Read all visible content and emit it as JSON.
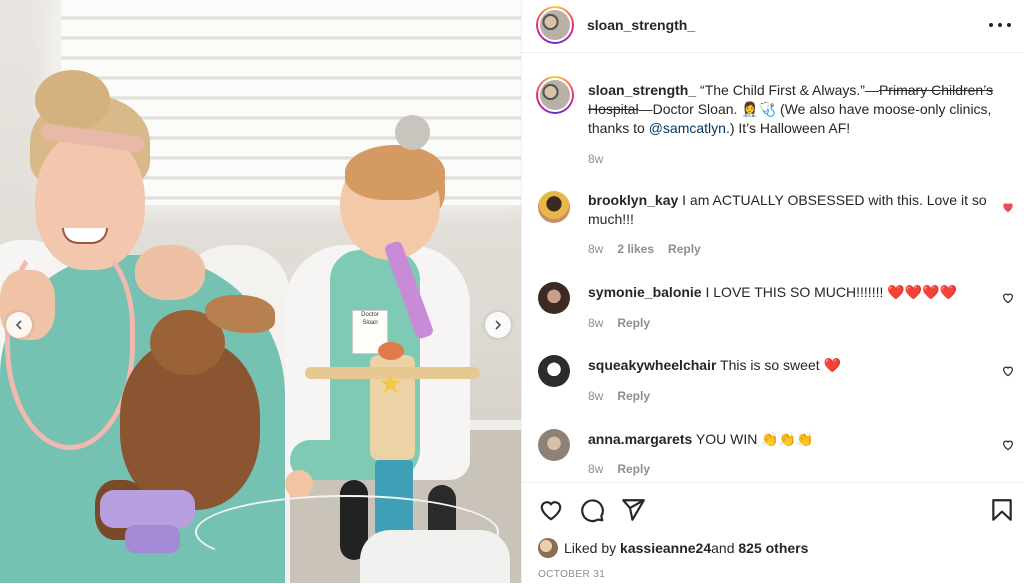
{
  "post": {
    "username": "sloan_strength_",
    "caption": {
      "username": "sloan_strength_",
      "quote": "“The Child First & Always.”—",
      "struck": "Primary Children’s Hospital",
      "after_strike": "—Doctor Sloan. 👩‍⚕️🩺 (We also have moose-only clinics, thanks to ",
      "mention": "@samcatlyn",
      "end": ".) It’s Halloween AF!",
      "time": "8w"
    },
    "photo": {
      "badge_text": "Doctor Sloan"
    },
    "comments": [
      {
        "username": "brooklyn_kay",
        "text": "I am ACTUALLY OBSESSED with this. Love it so much!!!",
        "time": "8w",
        "likes": "2 likes",
        "reply": "Reply",
        "liked": true,
        "avatar_color": "#c98b6b"
      },
      {
        "username": "symonie_balonie",
        "text": "I LOVE THIS SO MUCH!!!!!!! ❤️❤️❤️❤️",
        "time": "8w",
        "likes": "",
        "reply": "Reply",
        "liked": false,
        "avatar_color": "#6b4a3e"
      },
      {
        "username": "squeakywheelchair",
        "text": "This is so sweet ❤️",
        "time": "8w",
        "likes": "",
        "reply": "Reply",
        "liked": false,
        "avatar_color": "#3a3a3a"
      },
      {
        "username": "anna.margarets",
        "text": "YOU WIN 👏👏👏",
        "time": "8w",
        "likes": "",
        "reply": "Reply",
        "liked": false,
        "avatar_color": "#9a8f86"
      }
    ],
    "likes": {
      "prefix": "Liked by ",
      "user": "kassieanne24",
      "mid": " and ",
      "others": "825 others"
    },
    "date": "OCTOBER 31",
    "colors": {
      "heart_liked": "#ed4956",
      "link": "#00376b",
      "muted": "#8e8e8e"
    },
    "icons": [
      "more-icon",
      "heart-icon",
      "comment-icon",
      "share-icon",
      "bookmark-icon",
      "chevron-left-icon",
      "chevron-right-icon"
    ]
  }
}
